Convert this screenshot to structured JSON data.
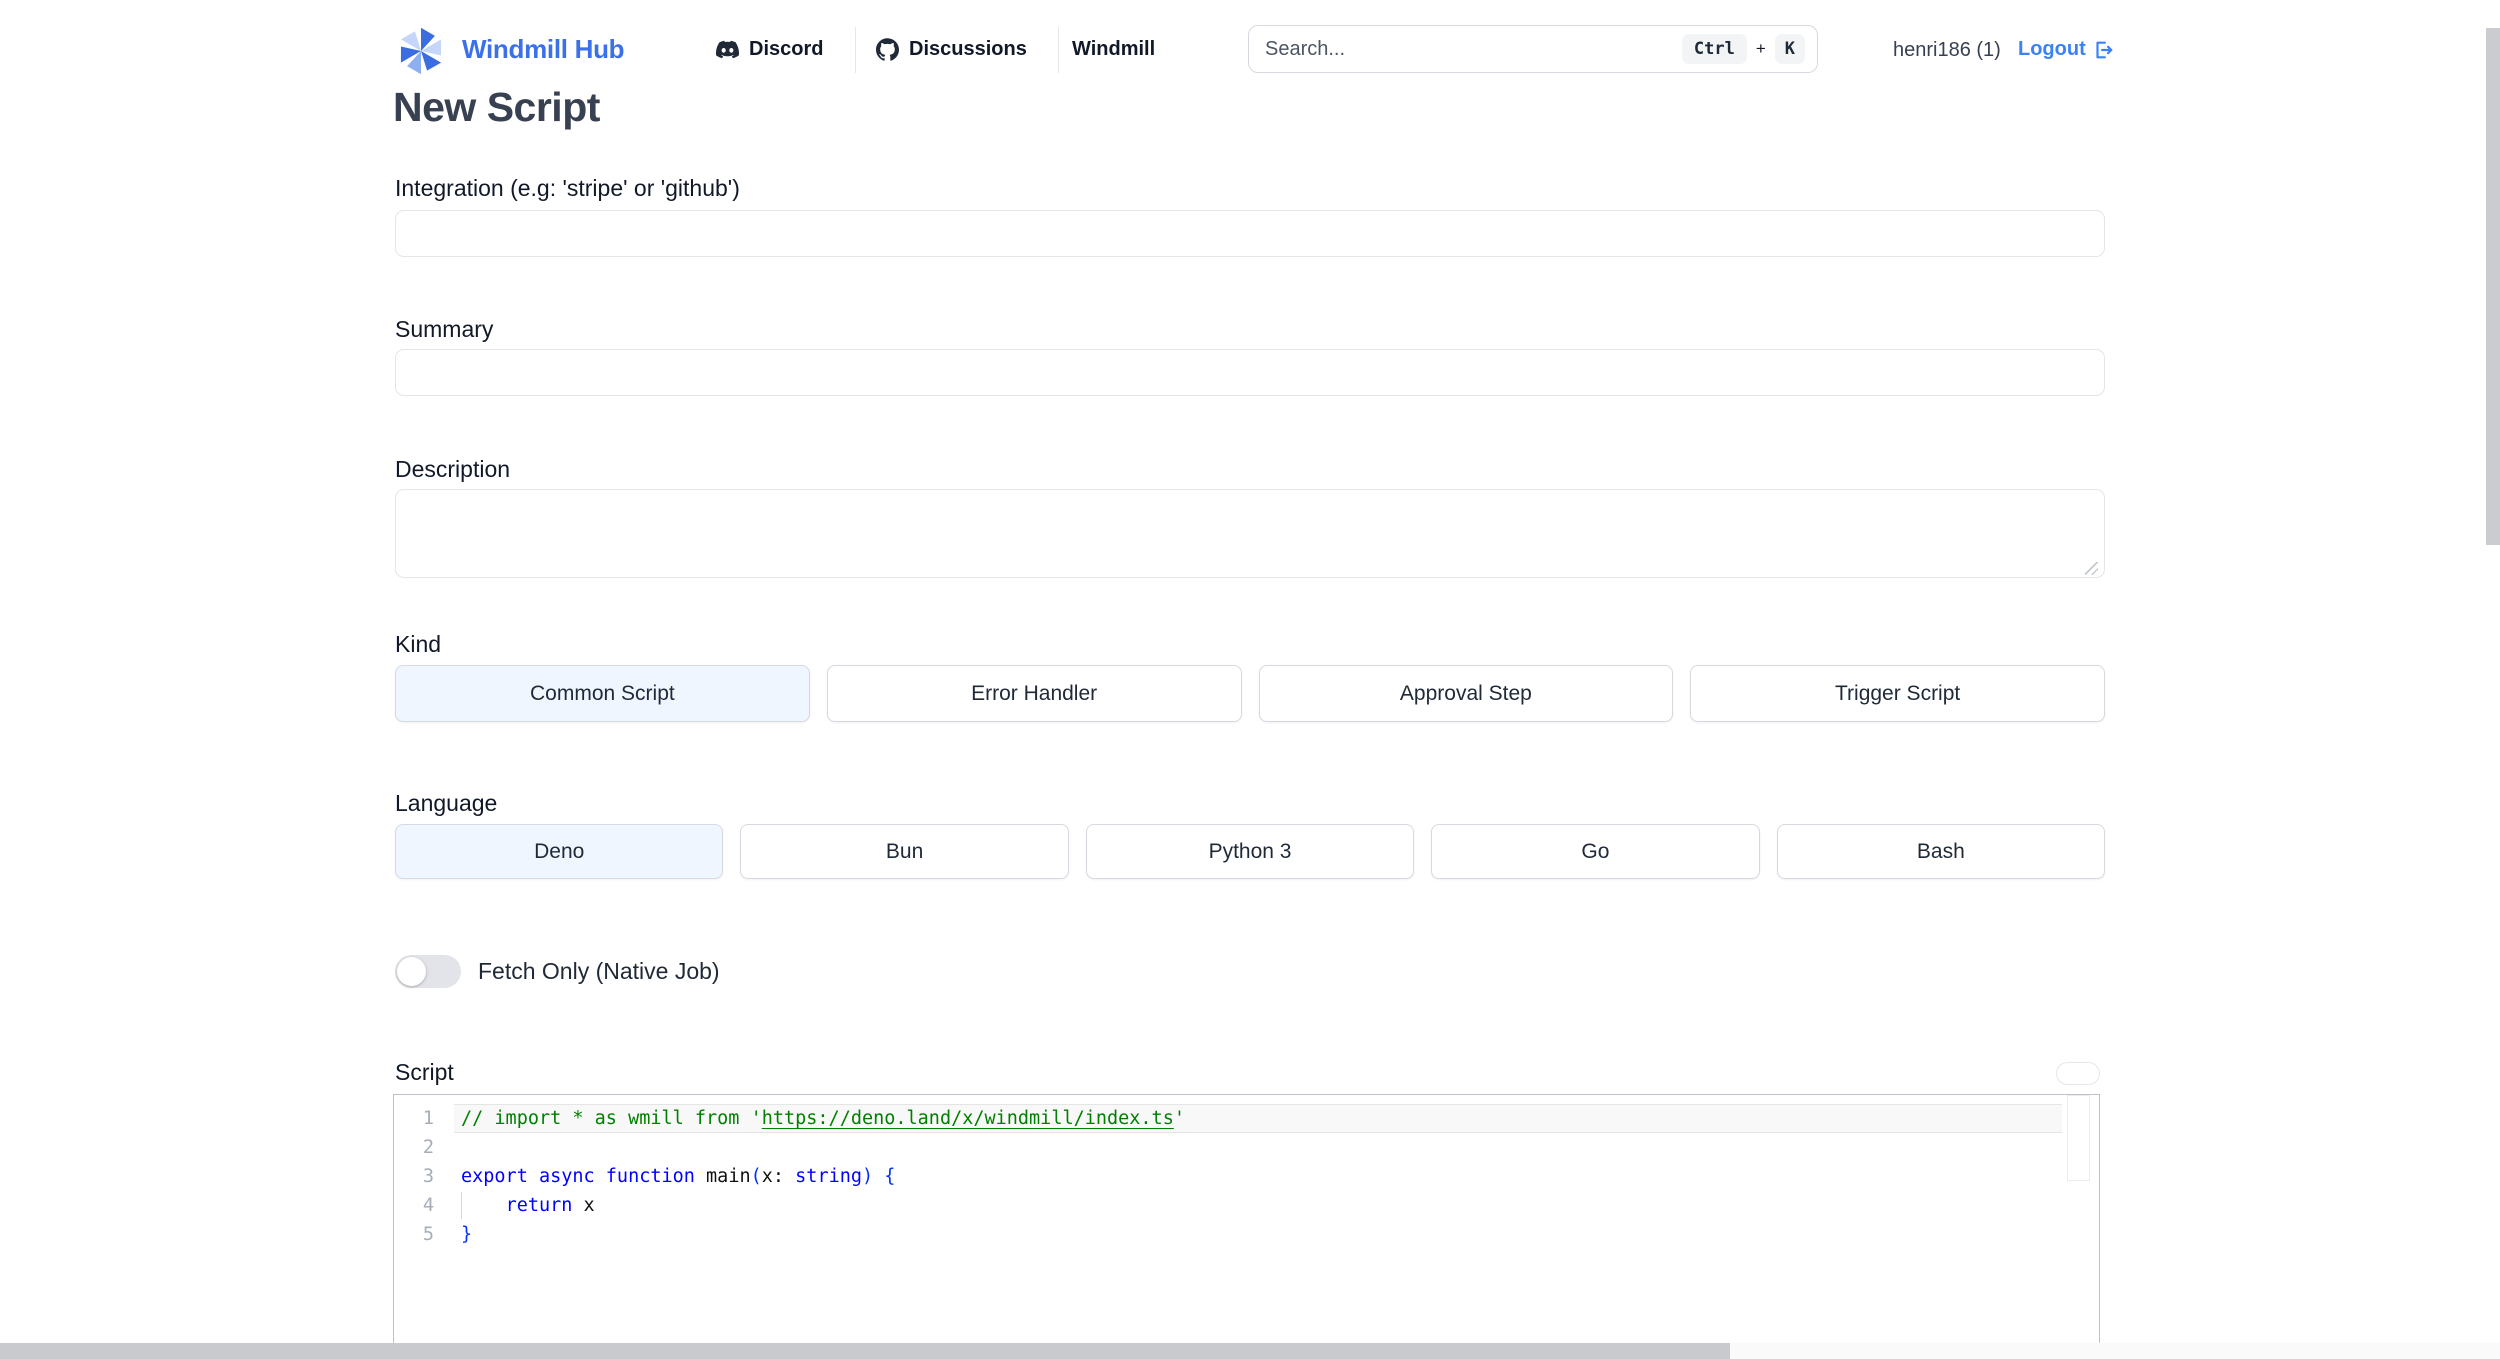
{
  "header": {
    "brand": "Windmill Hub",
    "nav": [
      {
        "label": "Discord",
        "icon": "discord-icon"
      },
      {
        "label": "Discussions",
        "icon": "github-icon"
      },
      {
        "label": "Windmill"
      }
    ],
    "search": {
      "placeholder": "Search...",
      "kbd_ctrl": "Ctrl",
      "kbd_plus": "+",
      "kbd_k": "K"
    },
    "user": "henri186 (1)",
    "logout_label": "Logout"
  },
  "page": {
    "title": "New Script"
  },
  "form": {
    "integration_label": "Integration (e.g: 'stripe' or 'github')",
    "integration_value": "",
    "summary_label": "Summary",
    "summary_value": "",
    "description_label": "Description",
    "description_value": "",
    "kind_label": "Kind",
    "kinds": [
      {
        "label": "Common Script",
        "selected": true
      },
      {
        "label": "Error Handler",
        "selected": false
      },
      {
        "label": "Approval Step",
        "selected": false
      },
      {
        "label": "Trigger Script",
        "selected": false
      }
    ],
    "language_label": "Language",
    "languages": [
      {
        "label": "Deno",
        "selected": true
      },
      {
        "label": "Bun",
        "selected": false
      },
      {
        "label": "Python 3",
        "selected": false
      },
      {
        "label": "Go",
        "selected": false
      },
      {
        "label": "Bash",
        "selected": false
      }
    ],
    "fetch_only_label": "Fetch Only (Native Job)",
    "fetch_only_on": false,
    "script_label": "Script"
  },
  "editor": {
    "lines": [
      {
        "n": "1",
        "highlight": true,
        "guide": false,
        "tokens": [
          {
            "t": "// import * as wmill from '",
            "c": "cm"
          },
          {
            "t": "https://deno.land/x/windmill/index.ts",
            "c": "cm",
            "u": true
          },
          {
            "t": "'",
            "c": "cm"
          }
        ]
      },
      {
        "n": "2",
        "highlight": false,
        "guide": false,
        "tokens": []
      },
      {
        "n": "3",
        "highlight": false,
        "guide": false,
        "tokens": [
          {
            "t": "export async function",
            "c": "kw"
          },
          {
            "t": " main",
            "c": "pl"
          },
          {
            "t": "(",
            "c": "br"
          },
          {
            "t": "x: ",
            "c": "pl"
          },
          {
            "t": "string",
            "c": "kw"
          },
          {
            "t": ")",
            "c": "br"
          },
          {
            "t": " ",
            "c": "pl"
          },
          {
            "t": "{",
            "c": "br"
          }
        ]
      },
      {
        "n": "4",
        "highlight": false,
        "guide": true,
        "tokens": [
          {
            "t": "    ",
            "c": "pl"
          },
          {
            "t": "return",
            "c": "kw"
          },
          {
            "t": " x",
            "c": "pl"
          }
        ]
      },
      {
        "n": "5",
        "highlight": false,
        "guide": false,
        "tokens": [
          {
            "t": "}",
            "c": "br"
          }
        ]
      }
    ]
  },
  "colors": {
    "brand_blue": "#3b70e8",
    "link_blue": "#3b82f6",
    "selected_bg": "#eff6ff",
    "comment_green": "#008000",
    "keyword_blue": "#0000ff",
    "bracket_blue": "#0431fa"
  }
}
